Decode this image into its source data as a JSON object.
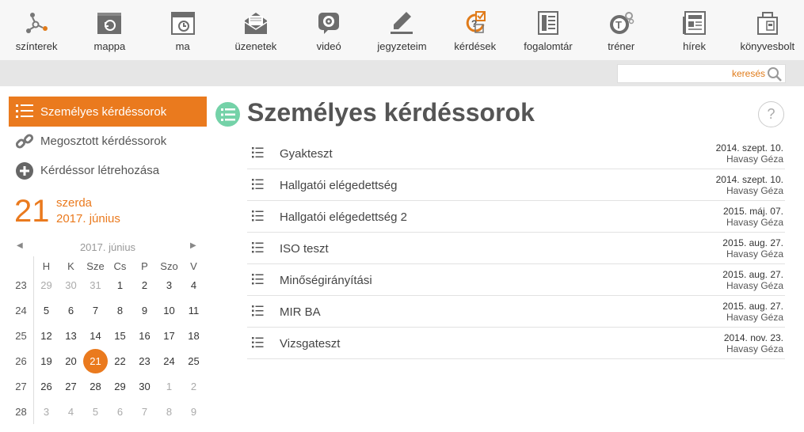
{
  "nav": [
    {
      "label": "színterek",
      "icon": "network-icon"
    },
    {
      "label": "mappa",
      "icon": "folder-icon"
    },
    {
      "label": "ma",
      "icon": "calendar-clock-icon"
    },
    {
      "label": "üzenetek",
      "icon": "envelope-icon"
    },
    {
      "label": "videó",
      "icon": "webcam-icon"
    },
    {
      "label": "jegyzeteim",
      "icon": "pencil-icon"
    },
    {
      "label": "kérdések",
      "icon": "question-checkbox-icon"
    },
    {
      "label": "fogalomtár",
      "icon": "glossary-icon"
    },
    {
      "label": "tréner",
      "icon": "trainer-gear-icon"
    },
    {
      "label": "hírek",
      "icon": "newspaper-icon"
    },
    {
      "label": "könyvesbolt",
      "icon": "shopping-bag-icon"
    }
  ],
  "search": {
    "placeholder": "keresés",
    "value": ""
  },
  "sidebar": {
    "items": [
      {
        "label": "Személyes kérdéssorok",
        "active": true
      },
      {
        "label": "Megosztott kérdéssorok",
        "active": false
      },
      {
        "label": "Kérdéssor létrehozása",
        "active": false
      }
    ]
  },
  "today": {
    "day": "21",
    "weekday": "szerda",
    "year_month": "2017. június"
  },
  "calendar": {
    "title": "2017. június",
    "prev": "◀",
    "next": "▶",
    "weekdays": [
      "H",
      "K",
      "Sze",
      "Cs",
      "P",
      "Szo",
      "V"
    ],
    "weeks": [
      {
        "num": "23",
        "days": [
          [
            "29",
            0
          ],
          [
            "30",
            0
          ],
          [
            "31",
            0
          ],
          [
            "1",
            1
          ],
          [
            "2",
            1
          ],
          [
            "3",
            1
          ],
          [
            "4",
            1
          ]
        ]
      },
      {
        "num": "24",
        "days": [
          [
            "5",
            1
          ],
          [
            "6",
            1
          ],
          [
            "7",
            1
          ],
          [
            "8",
            1
          ],
          [
            "9",
            1
          ],
          [
            "10",
            1
          ],
          [
            "11",
            1
          ]
        ]
      },
      {
        "num": "25",
        "days": [
          [
            "12",
            1
          ],
          [
            "13",
            1
          ],
          [
            "14",
            1
          ],
          [
            "15",
            1
          ],
          [
            "16",
            1
          ],
          [
            "17",
            1
          ],
          [
            "18",
            1
          ]
        ]
      },
      {
        "num": "26",
        "days": [
          [
            "19",
            1
          ],
          [
            "20",
            1
          ],
          [
            "21",
            2
          ],
          [
            "22",
            1
          ],
          [
            "23",
            1
          ],
          [
            "24",
            1
          ],
          [
            "25",
            1
          ]
        ]
      },
      {
        "num": "27",
        "days": [
          [
            "26",
            1
          ],
          [
            "27",
            1
          ],
          [
            "28",
            1
          ],
          [
            "29",
            1
          ],
          [
            "30",
            1
          ],
          [
            "1",
            0
          ],
          [
            "2",
            0
          ]
        ]
      },
      {
        "num": "28",
        "days": [
          [
            "3",
            0
          ],
          [
            "4",
            0
          ],
          [
            "5",
            0
          ],
          [
            "6",
            0
          ],
          [
            "7",
            0
          ],
          [
            "8",
            0
          ],
          [
            "9",
            0
          ]
        ]
      }
    ]
  },
  "main": {
    "title": "Személyes kérdéssorok",
    "help": "?",
    "rows": [
      {
        "name": "Gyakteszt",
        "date": "2014. szept. 10.",
        "author": "Havasy Géza"
      },
      {
        "name": "Hallgatói elégedettség",
        "date": "2014. szept. 10.",
        "author": "Havasy Géza"
      },
      {
        "name": "Hallgatói elégedettség 2",
        "date": "2015. máj. 07.",
        "author": "Havasy Géza"
      },
      {
        "name": "ISO teszt",
        "date": "2015. aug. 27.",
        "author": "Havasy Géza"
      },
      {
        "name": "Minőségirányítási",
        "date": "2015. aug. 27.",
        "author": "Havasy Géza"
      },
      {
        "name": "MIR BA",
        "date": "2015. aug. 27.",
        "author": "Havasy Géza"
      },
      {
        "name": "Vizsgateszt",
        "date": "2014. nov. 23.",
        "author": "Havasy Géza"
      }
    ]
  },
  "colors": {
    "accent": "#ea7a1e",
    "green": "#74d2a8",
    "icon_gray": "#6d6d6d"
  }
}
